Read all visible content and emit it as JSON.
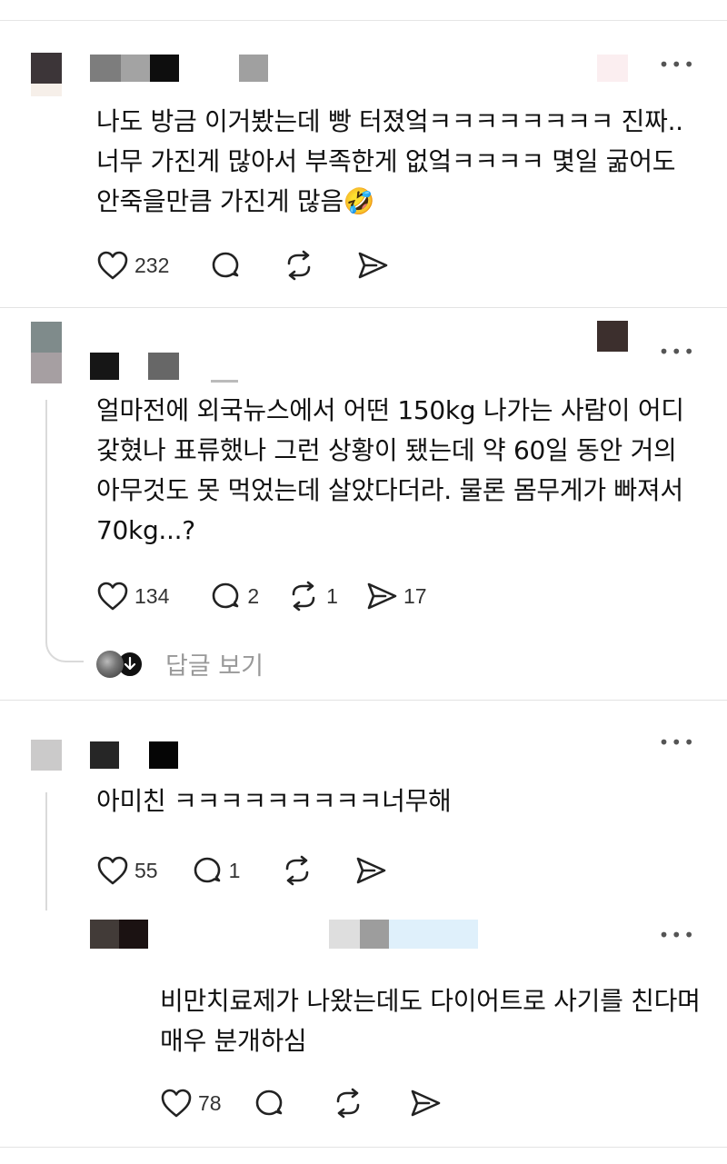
{
  "posts": [
    {
      "text": "나도 방금 이거봤는데 빵 터졌엌ㅋㅋㅋㅋㅋㅋㅋㅋ 진짜.. 너무 가진게 많아서 부족한게 없엌ㅋㅋㅋㅋ 몇일 굶어도 안죽을만큼 가진게 많음🤣",
      "likes": "232",
      "comments": "",
      "reposts": "",
      "shares": ""
    },
    {
      "text": "얼마전에 외국뉴스에서 어떤 150kg 나가는 사람이 어디 갗혔나 표류했나 그런 상황이 됐는데 약 60일 동안 거의 아무것도 못 먹었는데 살았다더라. 물론 몸무게가 빠져서 70kg...?",
      "likes": "134",
      "comments": "2",
      "reposts": "1",
      "shares": "17",
      "view_replies": "답글 보기"
    },
    {
      "text": "아미친 ㅋㅋㅋㅋㅋㅋㅋㅋㅋ너무해",
      "likes": "55",
      "comments": "1",
      "reposts": "",
      "shares": ""
    },
    {
      "text": "비만치료제가 나왔는데도 다이어트로 사기를 친다며 매우 분개하심",
      "likes": "78",
      "comments": "",
      "reposts": "",
      "shares": ""
    }
  ],
  "icons": {
    "like": "heart-icon",
    "comment": "comment-icon",
    "repost": "repost-icon",
    "share": "share-icon",
    "more": "more-icon"
  },
  "colors": {
    "text": "#111111",
    "muted": "#999999",
    "divider": "#e3e3e3"
  }
}
